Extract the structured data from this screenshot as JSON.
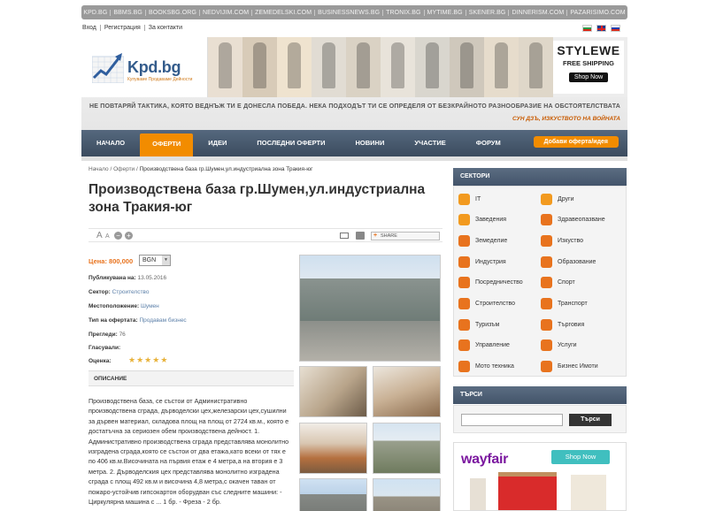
{
  "topbar": {
    "links": [
      "KPD.BG",
      "BBMS.BG",
      "BOOKSBG.ORG",
      "NEDVIJIM.COM",
      "ZEMEDELSKI.COM",
      "BUSINESSNEWS.BG",
      "TRONIX.BG",
      "MYTIME.BG",
      "SKENER.BG",
      "DINNERISM.COM",
      "PAZARISIMO.COM"
    ]
  },
  "userlinks": [
    "Вход",
    "Регистрация",
    "За контакти"
  ],
  "flags": [
    "bg",
    "en",
    "ru"
  ],
  "logo": {
    "name": "Kpd.bg",
    "tagline": "Купуваме Продаваме Дейности"
  },
  "ad_top": {
    "brand": "STYLEWE",
    "shipping": "FREE SHIPPING",
    "button": "Shop Now"
  },
  "slogan": {
    "text": "НЕ ПОВТАРЯЙ ТАКТИКА, КОЯТО ВЕДНЪЖ ТИ Е ДОНЕСЛА ПОБЕДА. НЕКА ПОДХОДЪТ ТИ СЕ ОПРЕДЕЛЯ ОТ БЕЗКРАЙНОТО РАЗНООБРАЗИЕ НА ОБСТОЯТЕЛСТВАТА",
    "author": "СУН ДЗЪ, ИЗКУСТВОТО НА ВОЙНАТА"
  },
  "nav": {
    "items": [
      "НАЧАЛО",
      "ОФЕРТИ",
      "ИДЕИ",
      "ПОСЛЕДНИ ОФЕРТИ",
      "НОВИНИ",
      "УЧАСТИЕ",
      "ФОРУМ"
    ],
    "active_index": 1,
    "add_button": "Добави оферта/идея"
  },
  "breadcrumb": {
    "home": "Начало",
    "section": "Оферти",
    "current": "Производствена база гр.Шумен,ул.индустриална зона Тракия-юг"
  },
  "title": "Производствена база гр.Шумен,ул.индустриална зона Тракия-юг",
  "tools": {
    "share_label": "SHARE"
  },
  "listing": {
    "price_label": "Цена: 800,000",
    "currency": "BGN",
    "published_label": "Публикувана на:",
    "published_value": "13.05.2016",
    "sector_label": "Сектор:",
    "sector_value": "Строителство",
    "location_label": "Местоположение:",
    "location_value": "Шумен",
    "type_label": "Тип на офертата:",
    "type_value": "Продавам бизнес",
    "views_label": "Прегледи:",
    "views_value": "76",
    "votes_label": "Гласували:",
    "votes_value": "",
    "rating_label": "Оценка:",
    "rating_stars": 5,
    "tab_label": "ОПИСАНИЕ",
    "description": "Производствена база, се състои от Административно производствена сграда, дърводелски цех,железарски цех,сушилни за дървен материал, складова площ на площ от 2724 кв.м., която е достатъчна за сериозен обем производствена дейност. 1. Административно производствена сграда представлява монолитно изградена сграда,която се състои от два етажа,като всеки от тях е по 406 кв.м.Височината на първия етаж е 4 метра,а на втория е 3 метра. 2. Дърводелския цех представлява монолитно изградена сграда с площ 492 кв.м и височина 4,8 метра,с окачен таван от пожаро-устойчив гипсокартон оборудван със следните машини: - Циркулярна машина с ... 1 бр. - Фреза - 2 бр."
  },
  "sidebar": {
    "sectors_title": "СЕКТОРИ",
    "sectors": [
      {
        "label": "IT",
        "color": "#f29a1f"
      },
      {
        "label": "Други",
        "color": "#f29a1f"
      },
      {
        "label": "Заведения",
        "color": "#f29a1f"
      },
      {
        "label": "Здравеопазване",
        "color": "#e8731e"
      },
      {
        "label": "Земеделие",
        "color": "#e8731e"
      },
      {
        "label": "Изкуство",
        "color": "#e8731e"
      },
      {
        "label": "Индустрия",
        "color": "#e8731e"
      },
      {
        "label": "Образование",
        "color": "#e8731e"
      },
      {
        "label": "Посредничество",
        "color": "#e8731e"
      },
      {
        "label": "Спорт",
        "color": "#e8731e"
      },
      {
        "label": "Строителство",
        "color": "#e8731e"
      },
      {
        "label": "Транспорт",
        "color": "#e8731e"
      },
      {
        "label": "Туризъм",
        "color": "#e8731e"
      },
      {
        "label": "Търговия",
        "color": "#e8731e"
      },
      {
        "label": "Управление",
        "color": "#e8731e"
      },
      {
        "label": "Услуги",
        "color": "#e8731e"
      },
      {
        "label": "Мото техника",
        "color": "#e8731e"
      },
      {
        "label": "Бизнес Имоти",
        "color": "#e8731e"
      }
    ],
    "search_title": "ТЪРСИ",
    "search_button": "Търси",
    "ad": {
      "brand": "wayfair",
      "button": "Shop Now"
    }
  },
  "colors": {
    "accent": "#f28c00",
    "nav": "#43546a",
    "link": "#5b7fa8"
  }
}
